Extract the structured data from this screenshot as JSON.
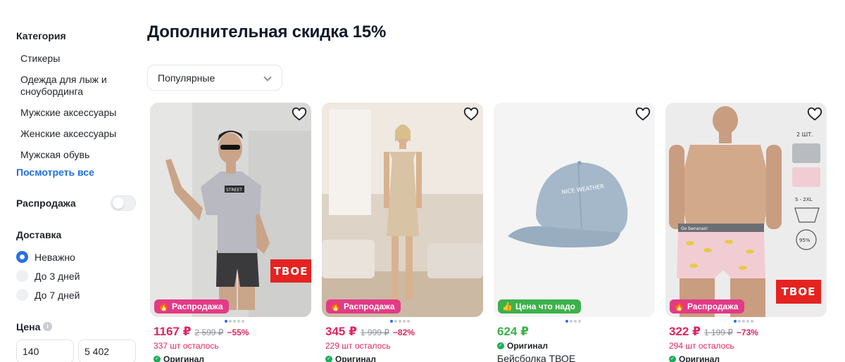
{
  "sidebar": {
    "category_title": "Категория",
    "categories": [
      "Стикеры",
      "Одежда для лыж и сноубординга",
      "Мужские аксессуары",
      "Женские аксессуары",
      "Мужская обувь"
    ],
    "see_all": "Посмотреть все",
    "sale_title": "Распродажа",
    "sale_toggle_on": false,
    "delivery_title": "Доставка",
    "delivery_options": [
      {
        "label": "Неважно",
        "checked": true
      },
      {
        "label": "До 3 дней",
        "checked": false
      },
      {
        "label": "До 7 дней",
        "checked": false
      }
    ],
    "price_title": "Цена",
    "price_min": "140",
    "price_max": "5 402"
  },
  "main": {
    "title": "Дополнительная скидка 15%",
    "sort_value": "Популярные"
  },
  "products": [
    {
      "badge": "Распродажа",
      "badge_color": "#e23a86",
      "brand_logo": "TBOE",
      "price": "1167 ₽",
      "old_price": "2 599 ₽",
      "discount": "−55%",
      "stock": "337 шт осталось",
      "original": "Оригинал",
      "name": "",
      "price_color": "#e0245e",
      "dots_active": 1,
      "dots_total": 5
    },
    {
      "badge": "Распродажа",
      "badge_color": "#e23a86",
      "brand_logo": "",
      "price": "345 ₽",
      "old_price": "1 999 ₽",
      "discount": "−82%",
      "stock": "229 шт осталось",
      "original": "Оригинал",
      "name": "",
      "price_color": "#e0245e",
      "dots_active": 0,
      "dots_total": 5
    },
    {
      "badge": "Цена что надо",
      "badge_color": "#3cb14a",
      "brand_logo": "",
      "price": "624 ₽",
      "old_price": "",
      "discount": "",
      "stock": "",
      "original": "Оригинал",
      "name": "Бейсболка ТВОЕ",
      "price_color": "#3cb14a",
      "dots_active": 0,
      "dots_total": 4
    },
    {
      "badge": "Распродажа",
      "badge_color": "#e23a86",
      "brand_logo": "TBOE",
      "price": "322 ₽",
      "old_price": "1 199 ₽",
      "discount": "−73%",
      "stock": "294 шт осталось",
      "original": "Оригинал",
      "name": "",
      "price_color": "#e0245e",
      "dots_active": 0,
      "dots_total": 5
    }
  ],
  "pack_labels": {
    "count": "2 ШТ.",
    "sizes": "S - 2XL",
    "cotton": "95%",
    "waistband": "Go bananas!"
  },
  "cap_text": "NICE WEATHER",
  "shirt_text": "STREET"
}
